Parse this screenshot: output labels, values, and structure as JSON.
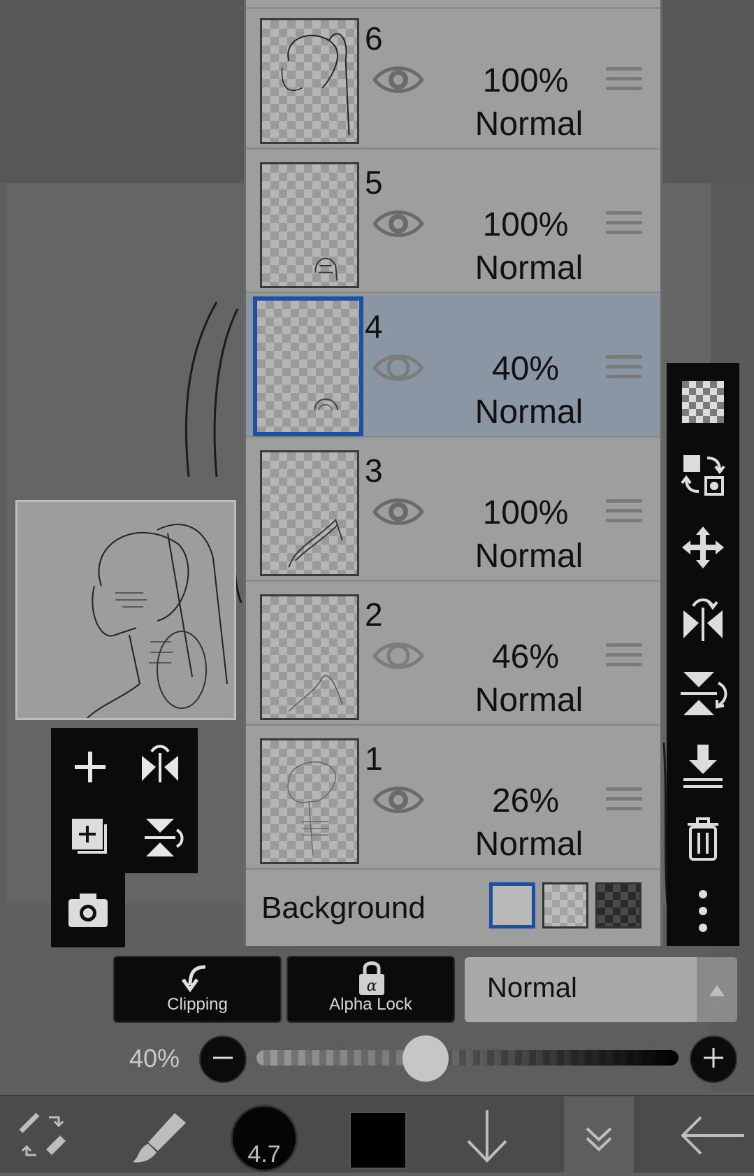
{
  "layers": [
    {
      "number": "6",
      "opacity": "100%",
      "mode": "Normal",
      "visible_dim": false,
      "selected": false
    },
    {
      "number": "5",
      "opacity": "100%",
      "mode": "Normal",
      "visible_dim": false,
      "selected": false
    },
    {
      "number": "4",
      "opacity": "40%",
      "mode": "Normal",
      "visible_dim": true,
      "selected": true
    },
    {
      "number": "3",
      "opacity": "100%",
      "mode": "Normal",
      "visible_dim": false,
      "selected": false
    },
    {
      "number": "2",
      "opacity": "46%",
      "mode": "Normal",
      "visible_dim": true,
      "selected": false
    },
    {
      "number": "1",
      "opacity": "26%",
      "mode": "Normal",
      "visible_dim": false,
      "selected": false
    }
  ],
  "background": {
    "label": "Background",
    "options": [
      "white",
      "light-checker",
      "dark-checker"
    ],
    "selected": "white"
  },
  "controls": {
    "clipping_label": "Clipping",
    "alpha_lock_label": "Alpha Lock",
    "blend_mode": "Normal",
    "opacity_label": "40%",
    "opacity_fraction": 0.4
  },
  "toolbar": {
    "brush_size": "4.7",
    "color": "#000000"
  },
  "colors": {
    "selection_accent": "#1e4fa0",
    "selected_row": "#8b96a4",
    "panel": "#9e9e9e"
  },
  "icons": {
    "right_toolbar": [
      "transparency-icon",
      "swap-icon",
      "move-icon",
      "flip-horizontal-icon",
      "flip-vertical-icon",
      "merge-down-icon",
      "trash-icon",
      "more-icon"
    ],
    "left_tools": [
      "add-layer-icon",
      "flip-horizontal-icon",
      "duplicate-layer-icon",
      "flip-vertical-icon",
      "camera-icon"
    ],
    "bottom_bar": [
      "transform-icon",
      "brush-icon",
      "brush-size",
      "color-swatch",
      "down-arrow-icon",
      "collapse-icon",
      "back-arrow-icon"
    ]
  }
}
